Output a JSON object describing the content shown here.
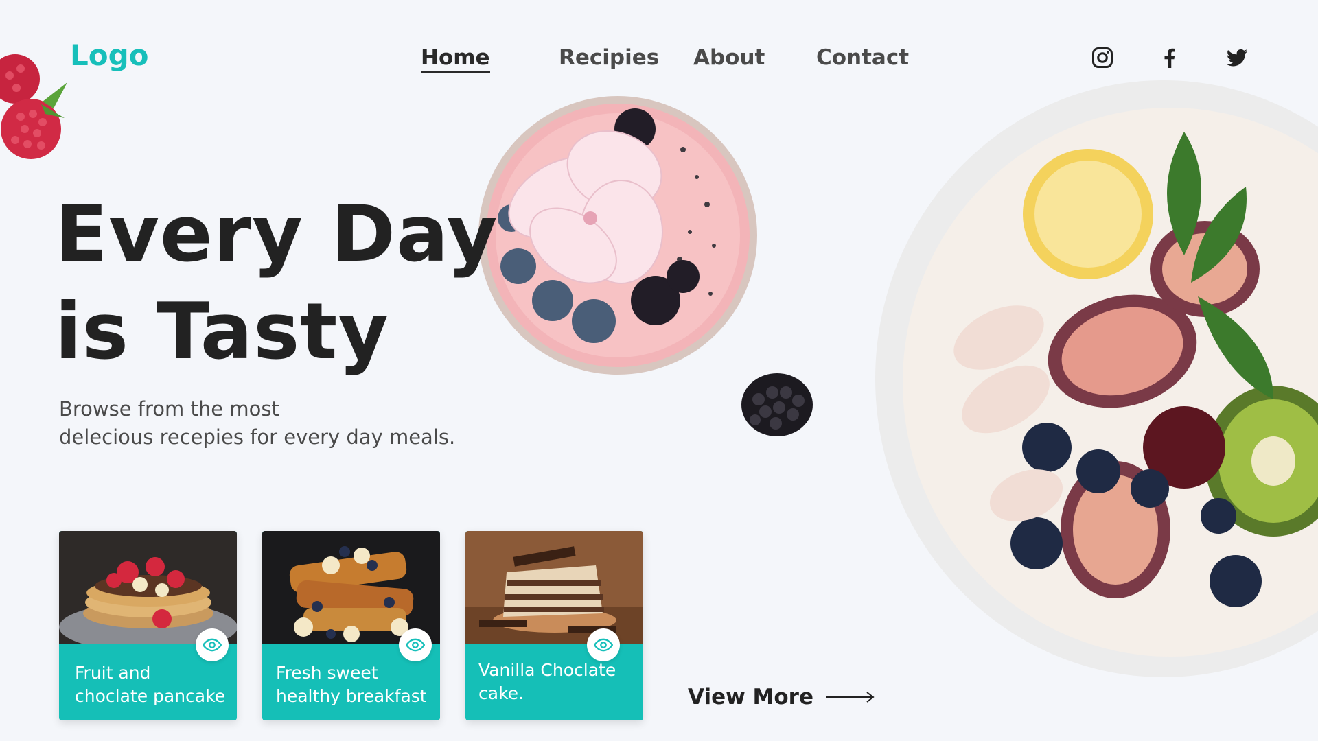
{
  "header": {
    "logo": "Logo",
    "nav": [
      {
        "label": "Home",
        "active": true
      },
      {
        "label": "Recipies",
        "active": false
      },
      {
        "label": "About",
        "active": false
      },
      {
        "label": "Contact",
        "active": false
      }
    ],
    "social": [
      "instagram-icon",
      "facebook-icon",
      "twitter-icon"
    ]
  },
  "hero": {
    "title_line1": "Every Day",
    "title_line2": "is Tasty",
    "subtitle_line1": "Browse from the most",
    "subtitle_line2": "delecious recepies for every day meals."
  },
  "cards": [
    {
      "title_line1": "Fruit and",
      "title_line2": "choclate pancake",
      "icon": "eye-icon"
    },
    {
      "title_line1": "Fresh sweet",
      "title_line2": "healthy breakfast",
      "icon": "eye-icon"
    },
    {
      "title_line1": "Vanilla Choclate",
      "title_line2": "cake.",
      "icon": "eye-icon"
    }
  ],
  "view_more": {
    "label": "View More",
    "icon": "arrow-right-icon"
  },
  "colors": {
    "accent": "#17bfba",
    "background": "#f4f6fa",
    "text": "#222222"
  }
}
